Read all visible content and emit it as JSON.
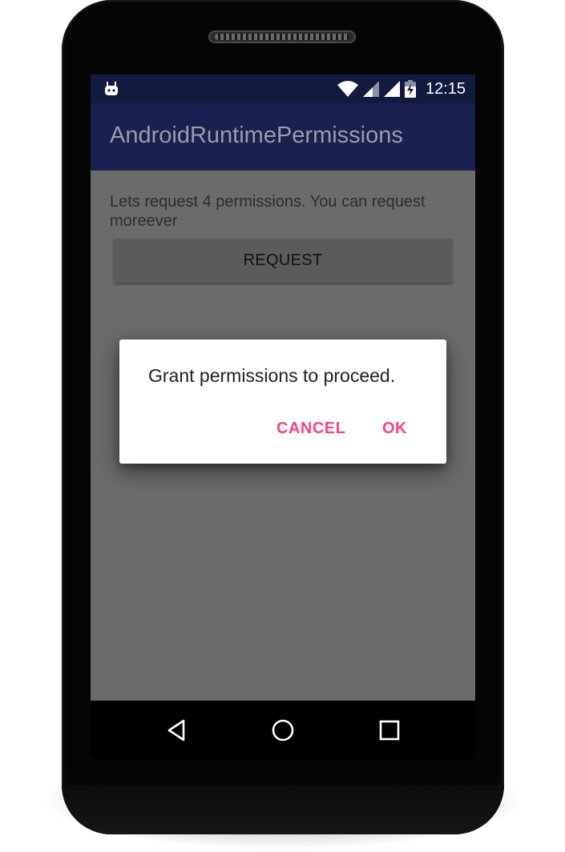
{
  "status_bar": {
    "time": "12:15",
    "left_icon": "android-notification-icon",
    "icons": [
      "wifi-icon",
      "signal-icon",
      "signal-icon",
      "battery-charging-icon"
    ]
  },
  "toolbar": {
    "title": "AndroidRuntimePermissions"
  },
  "content": {
    "description": "Lets request 4 permissions. You can request moreever",
    "request_button_label": "REQUEST"
  },
  "dialog": {
    "message": "Grant permissions to proceed.",
    "cancel_label": "CANCEL",
    "ok_label": "OK"
  },
  "navigation_bar": {
    "buttons": [
      "back-icon",
      "home-icon",
      "recents-icon"
    ]
  },
  "colors": {
    "status_bar": "#121a3d",
    "toolbar": "#1a2050",
    "accent": "#ff4081",
    "dimmed_background": "#6b6b6b"
  }
}
